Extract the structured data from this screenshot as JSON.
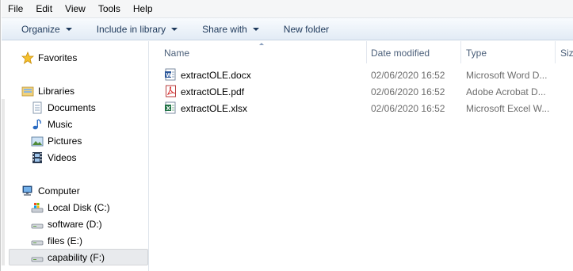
{
  "menu": [
    "File",
    "Edit",
    "View",
    "Tools",
    "Help"
  ],
  "toolbar": {
    "organize": "Organize",
    "include_in_library": "Include in library",
    "share_with": "Share with",
    "new_folder": "New folder"
  },
  "nav": {
    "favorites": "Favorites",
    "libraries": "Libraries",
    "documents": "Documents",
    "music": "Music",
    "pictures": "Pictures",
    "videos": "Videos",
    "computer": "Computer",
    "drives": [
      "Local Disk (C:)",
      "software (D:)",
      "files (E:)",
      "capability (F:)"
    ],
    "selected": "capability (F:)"
  },
  "columns": {
    "name": "Name",
    "date_modified": "Date modified",
    "type": "Type",
    "size": "Siz"
  },
  "files": [
    {
      "name": "extractOLE.docx",
      "date": "02/06/2020 16:52",
      "type": "Microsoft Word D...",
      "icon": "word-doc-icon"
    },
    {
      "name": "extractOLE.pdf",
      "date": "02/06/2020 16:52",
      "type": "Adobe Acrobat D...",
      "icon": "pdf-icon"
    },
    {
      "name": "extractOLE.xlsx",
      "date": "02/06/2020 16:52",
      "type": "Microsoft Excel W...",
      "icon": "excel-icon"
    }
  ],
  "colors": {
    "command_text": "#1e395b",
    "header_text": "#4c607a",
    "selected_bg": "#e8eaed"
  }
}
